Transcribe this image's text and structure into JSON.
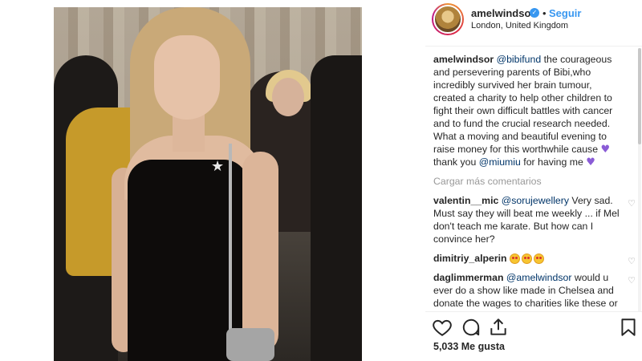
{
  "post": {
    "username": "amelwindsor",
    "verified_icon": "verified-badge-icon",
    "separator": "•",
    "follow_label": "Seguir",
    "location": "London, United Kingdom"
  },
  "caption": {
    "username": "amelwindsor",
    "mention": "@bibifund",
    "text_part1": " the courageous and persevering parents of Bibi,who incredibly survived her brain tumour, created a charity to help other children to fight their own difficult battles with cancer and to fund the crucial research needed. What a moving and beautiful evening to raise money for this worthwhile cause ",
    "heart1": "♥",
    "text_part2": " thank you ",
    "mention2": "@miumiu",
    "text_part3": " for having me ",
    "heart2": "♥"
  },
  "load_more_label": "Cargar más comentarios",
  "comments": [
    {
      "username": "valentin__mic",
      "mention": "@sorujewellery",
      "text": " Very sad. Must say they will beat me weekly ... if Mel don't teach me karate. But how can I convince her?"
    },
    {
      "username": "dimitriy_alperin",
      "emoji": "heart-eyes-emoji x3"
    },
    {
      "username": "daglimmerman",
      "mention": "@amelwindsor",
      "text": " would u ever do a show like made in Chelsea and donate the wages to charities like these or does the Crown prevent you??"
    }
  ],
  "like_icon": "♡",
  "likes_label": "5,033 Me gusta",
  "colors": {
    "link_blue": "#3897f0",
    "mention_blue": "#003569",
    "heart_purple": "#8a5cd6"
  }
}
